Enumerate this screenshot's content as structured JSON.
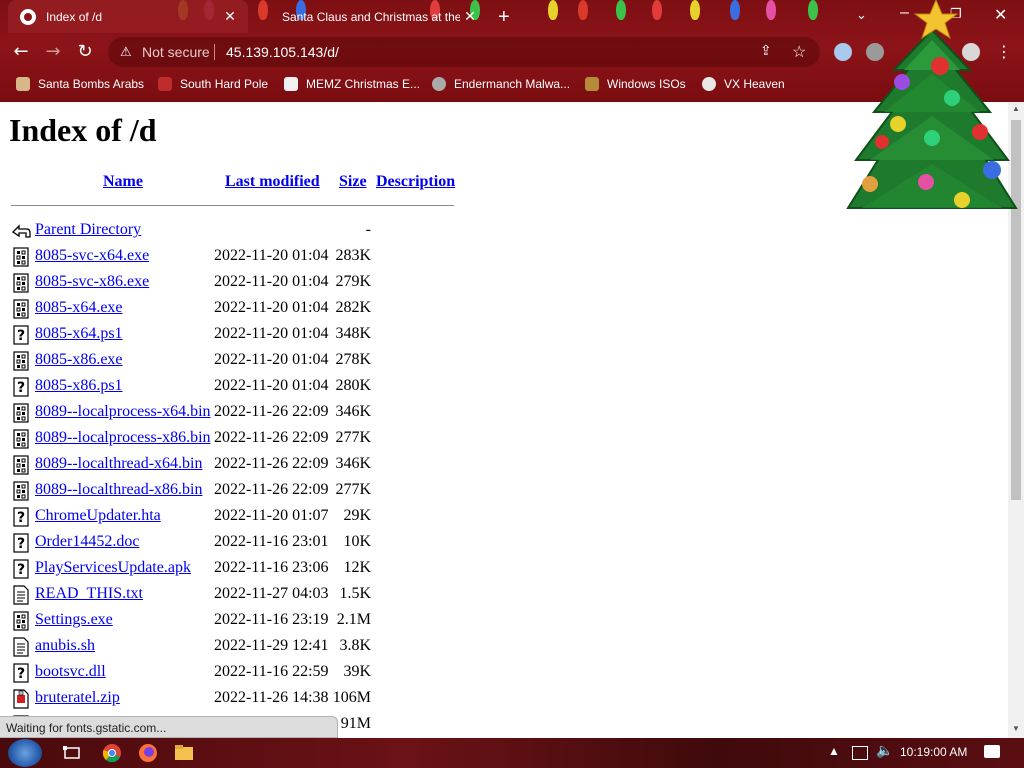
{
  "browser": {
    "tabs": [
      {
        "title": "Index of /d",
        "active": true
      },
      {
        "title": "Santa Claus and Christmas at the",
        "active": false
      }
    ],
    "address": {
      "security_label": "Not secure",
      "url": "45.139.105.143/d/"
    },
    "bookmarks": [
      {
        "label": "Santa Bombs Arabs",
        "icon": "bomb-icon"
      },
      {
        "label": "South Hard Pole",
        "icon": "snowflake-icon"
      },
      {
        "label": "MEMZ Christmas E...",
        "icon": "page-icon"
      },
      {
        "label": "Endermanch Malwa...",
        "icon": "cat-icon"
      },
      {
        "label": "Windows ISOs",
        "icon": "tree-icon"
      },
      {
        "label": "VX Heaven",
        "icon": "skull-icon"
      }
    ],
    "status_text": "Waiting for fonts.gstatic.com..."
  },
  "page": {
    "title": "Index of /d",
    "columns": [
      "Name",
      "Last modified",
      "Size",
      "Description"
    ],
    "parent": {
      "name": "Parent Directory",
      "size": "-"
    },
    "files": [
      {
        "name": "8085-svc-x64.exe",
        "modified": "2022-11-20 01:04",
        "size": "283K",
        "icon": "binary"
      },
      {
        "name": "8085-svc-x86.exe",
        "modified": "2022-11-20 01:04",
        "size": "279K",
        "icon": "binary"
      },
      {
        "name": "8085-x64.exe",
        "modified": "2022-11-20 01:04",
        "size": "282K",
        "icon": "binary"
      },
      {
        "name": "8085-x64.ps1",
        "modified": "2022-11-20 01:04",
        "size": "348K",
        "icon": "unknown"
      },
      {
        "name": "8085-x86.exe",
        "modified": "2022-11-20 01:04",
        "size": "278K",
        "icon": "binary"
      },
      {
        "name": "8085-x86.ps1",
        "modified": "2022-11-20 01:04",
        "size": "280K",
        "icon": "unknown"
      },
      {
        "name": "8089--localprocess-x64.bin",
        "modified": "2022-11-26 22:09",
        "size": "346K",
        "icon": "binary"
      },
      {
        "name": "8089--localprocess-x86.bin",
        "modified": "2022-11-26 22:09",
        "size": "277K",
        "icon": "binary"
      },
      {
        "name": "8089--localthread-x64.bin",
        "modified": "2022-11-26 22:09",
        "size": "346K",
        "icon": "binary"
      },
      {
        "name": "8089--localthread-x86.bin",
        "modified": "2022-11-26 22:09",
        "size": "277K",
        "icon": "binary"
      },
      {
        "name": "ChromeUpdater.hta",
        "modified": "2022-11-20 01:07",
        "size": "29K",
        "icon": "unknown"
      },
      {
        "name": "Order14452.doc",
        "modified": "2022-11-16 23:01",
        "size": "10K",
        "icon": "unknown"
      },
      {
        "name": "PlayServicesUpdate.apk",
        "modified": "2022-11-16 23:06",
        "size": "12K",
        "icon": "unknown"
      },
      {
        "name": "READ_THIS.txt",
        "modified": "2022-11-27 04:03",
        "size": "1.5K",
        "icon": "text"
      },
      {
        "name": "Settings.exe",
        "modified": "2022-11-16 23:19",
        "size": "2.1M",
        "icon": "binary"
      },
      {
        "name": "anubis.sh",
        "modified": "2022-11-29 12:41",
        "size": "3.8K",
        "icon": "text"
      },
      {
        "name": "bootsvc.dll",
        "modified": "2022-11-16 22:59",
        "size": "39K",
        "icon": "unknown"
      },
      {
        "name": "bruteratel.zip",
        "modified": "2022-11-26 14:38",
        "size": "106M",
        "icon": "compressed"
      },
      {
        "name": "",
        "modified": "",
        "size": "91M",
        "icon": "binary"
      }
    ]
  },
  "taskbar": {
    "clock": "10:19:00 AM"
  },
  "colors": {
    "chrome_bg": "#8c1418",
    "link": "#0000ee"
  }
}
